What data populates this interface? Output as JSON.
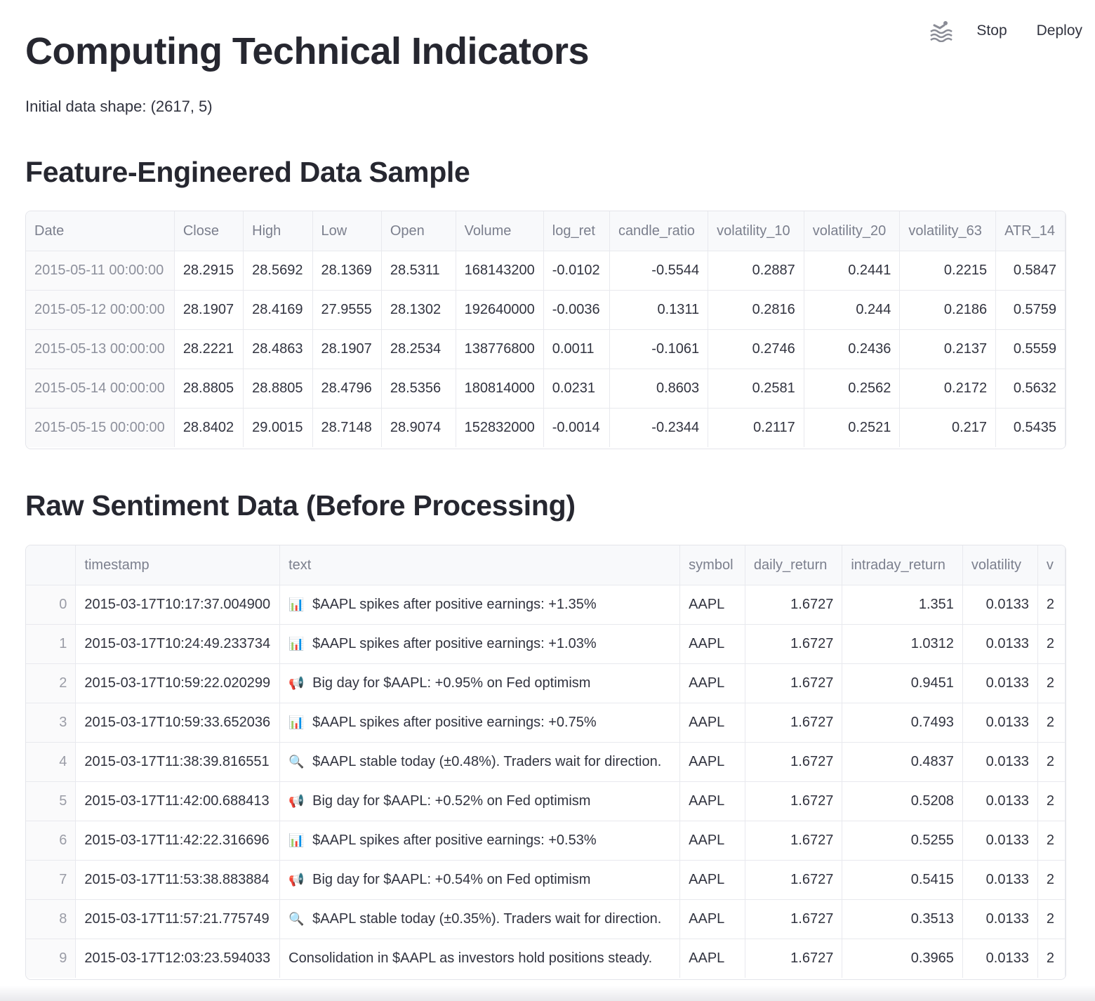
{
  "toolbar": {
    "stop_label": "Stop",
    "deploy_label": "Deploy",
    "status_icon": "running-swimmer-icon"
  },
  "page": {
    "title": "Computing Technical Indicators",
    "shape_text": "Initial data shape: (2617, 5)"
  },
  "features": {
    "heading": "Feature-Engineered Data Sample",
    "columns": [
      "Date",
      "Close",
      "High",
      "Low",
      "Open",
      "Volume",
      "log_ret",
      "candle_ratio",
      "volatility_10",
      "volatility_20",
      "volatility_63",
      "ATR_14"
    ],
    "rows": [
      [
        "2015-05-11 00:00:00",
        "28.2915",
        "28.5692",
        "28.1369",
        "28.5311",
        "168143200",
        "-0.0102",
        "-0.5544",
        "0.2887",
        "0.2441",
        "0.2215",
        "0.5847"
      ],
      [
        "2015-05-12 00:00:00",
        "28.1907",
        "28.4169",
        "27.9555",
        "28.1302",
        "192640000",
        "-0.0036",
        "0.1311",
        "0.2816",
        "0.244",
        "0.2186",
        "0.5759"
      ],
      [
        "2015-05-13 00:00:00",
        "28.2221",
        "28.4863",
        "28.1907",
        "28.2534",
        "138776800",
        "0.0011",
        "-0.1061",
        "0.2746",
        "0.2436",
        "0.2137",
        "0.5559"
      ],
      [
        "2015-05-14 00:00:00",
        "28.8805",
        "28.8805",
        "28.4796",
        "28.5356",
        "180814000",
        "0.0231",
        "0.8603",
        "0.2581",
        "0.2562",
        "0.2172",
        "0.5632"
      ],
      [
        "2015-05-15 00:00:00",
        "28.8402",
        "29.0015",
        "28.7148",
        "28.9074",
        "152832000",
        "-0.0014",
        "-0.2344",
        "0.2117",
        "0.2521",
        "0.217",
        "0.5435"
      ]
    ]
  },
  "sentiment": {
    "heading": "Raw Sentiment Data (Before Processing)",
    "columns": [
      "",
      "timestamp",
      "text",
      "symbol",
      "daily_return",
      "intraday_return",
      "volatility",
      "v"
    ],
    "rows": [
      [
        "0",
        "2015-03-17T10:17:37.004900",
        "bar-chart-emoji",
        "$AAPL spikes after positive earnings: +1.35%",
        "AAPL",
        "1.6727",
        "1.351",
        "0.0133",
        "2"
      ],
      [
        "1",
        "2015-03-17T10:24:49.233734",
        "bar-chart-emoji",
        "$AAPL spikes after positive earnings: +1.03%",
        "AAPL",
        "1.6727",
        "1.0312",
        "0.0133",
        "2"
      ],
      [
        "2",
        "2015-03-17T10:59:22.020299",
        "megaphone-emoji",
        "Big day for $AAPL: +0.95% on Fed optimism",
        "AAPL",
        "1.6727",
        "0.9451",
        "0.0133",
        "2"
      ],
      [
        "3",
        "2015-03-17T10:59:33.652036",
        "bar-chart-emoji",
        "$AAPL spikes after positive earnings: +0.75%",
        "AAPL",
        "1.6727",
        "0.7493",
        "0.0133",
        "2"
      ],
      [
        "4",
        "2015-03-17T11:38:39.816551",
        "magnifier-emoji",
        "$AAPL stable today (±0.48%). Traders wait for direction.",
        "AAPL",
        "1.6727",
        "0.4837",
        "0.0133",
        "2"
      ],
      [
        "5",
        "2015-03-17T11:42:00.688413",
        "megaphone-emoji",
        "Big day for $AAPL: +0.52% on Fed optimism",
        "AAPL",
        "1.6727",
        "0.5208",
        "0.0133",
        "2"
      ],
      [
        "6",
        "2015-03-17T11:42:22.316696",
        "bar-chart-emoji",
        "$AAPL spikes after positive earnings: +0.53%",
        "AAPL",
        "1.6727",
        "0.5255",
        "0.0133",
        "2"
      ],
      [
        "7",
        "2015-03-17T11:53:38.883884",
        "megaphone-emoji",
        "Big day for $AAPL: +0.54% on Fed optimism",
        "AAPL",
        "1.6727",
        "0.5415",
        "0.0133",
        "2"
      ],
      [
        "8",
        "2015-03-17T11:57:21.775749",
        "magnifier-emoji",
        "$AAPL stable today (±0.35%). Traders wait for direction.",
        "AAPL",
        "1.6727",
        "0.3513",
        "0.0133",
        "2"
      ],
      [
        "9",
        "2015-03-17T12:03:23.594033",
        "",
        "Consolidation in $AAPL as investors hold positions steady.",
        "AAPL",
        "1.6727",
        "0.3965",
        "0.0133",
        "2"
      ]
    ]
  }
}
